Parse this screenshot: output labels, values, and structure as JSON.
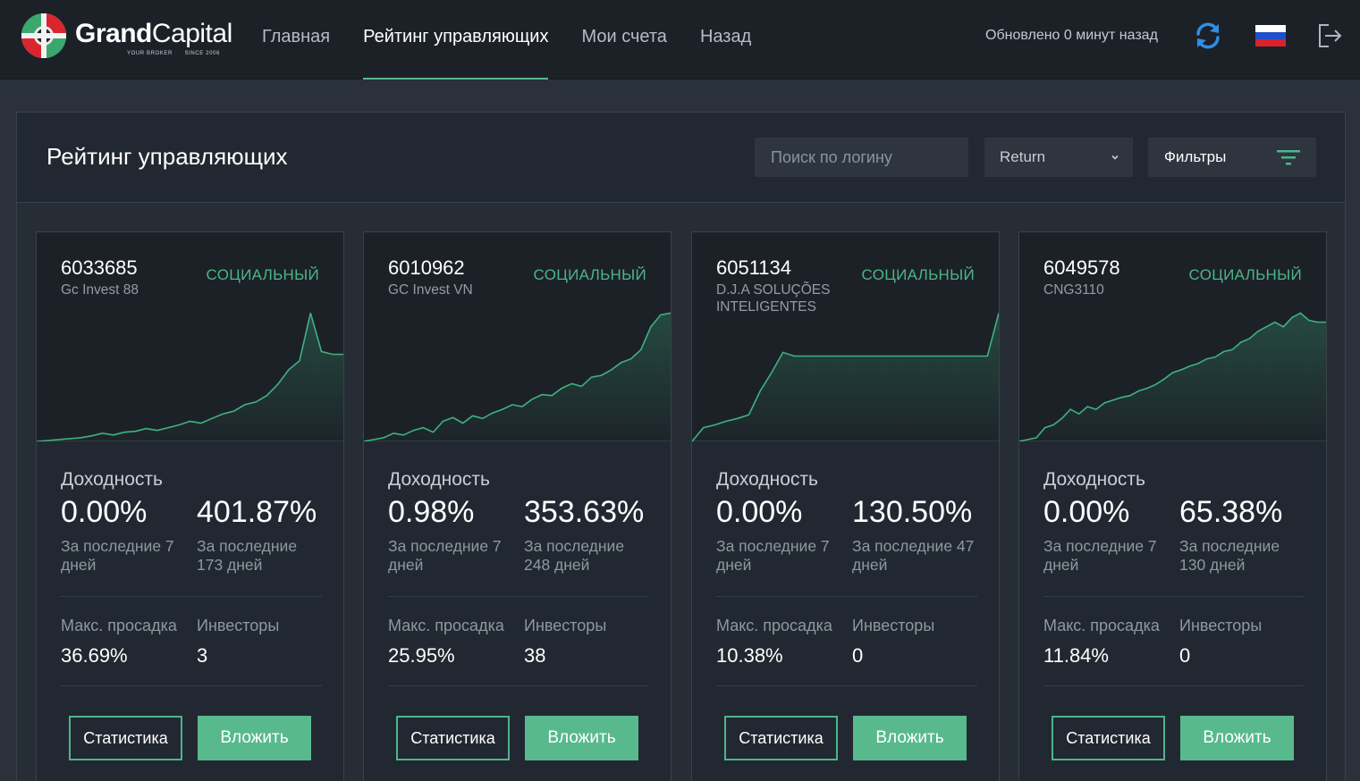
{
  "header": {
    "logo": {
      "brand_bold": "Grand",
      "brand_light": "Capital",
      "tagline_left": "YOUR BROKER",
      "tagline_right": "SINCE 2006"
    },
    "nav": [
      {
        "label": "Главная",
        "active": false
      },
      {
        "label": "Рейтинг управляющих",
        "active": true
      },
      {
        "label": "Мои счета",
        "active": false
      },
      {
        "label": "Назад",
        "active": false
      }
    ],
    "updated_text": "Обновлено 0 минут назад",
    "language_flag": "russia-flag",
    "icons": [
      "refresh-icon",
      "logout-icon"
    ]
  },
  "page": {
    "title": "Рейтинг управляющих",
    "search_placeholder": "Поиск по логину",
    "sort_value": "Return",
    "filters_label": "Фильтры"
  },
  "labels": {
    "section_title": "Доходность",
    "last7": "За последние 7 дней",
    "max_drawdown": "Макс. просадка",
    "investors": "Инвесторы",
    "stats_button": "Статистика",
    "invest_button": "Вложить"
  },
  "colors": {
    "accent": "#4cb687",
    "button": "#58b98d",
    "chart_line": "#3fb27f"
  },
  "cards": [
    {
      "login": "6033685",
      "name": "Gc Invest 88",
      "tag": "СОЦИАЛЬНЫЙ",
      "return_7d": "0.00%",
      "return_total": "401.87%",
      "total_period": "За последние 173 дней",
      "max_drawdown": "36.69%",
      "investors": "3",
      "chart_data": {
        "type": "area",
        "y": [
          0,
          1,
          2,
          3,
          4,
          6,
          9,
          7,
          10,
          11,
          14,
          12,
          15,
          18,
          22,
          20,
          25,
          30,
          33,
          40,
          43,
          50,
          62,
          78,
          88,
          140,
          98,
          95,
          95
        ],
        "ylim": [
          0,
          150
        ]
      }
    },
    {
      "login": "6010962",
      "name": "GC Invest VN",
      "tag": "СОЦИАЛЬНЫЙ",
      "return_7d": "0.98%",
      "return_total": "353.63%",
      "total_period": "За последние 248 дней",
      "max_drawdown": "25.95%",
      "investors": "38",
      "chart_data": {
        "type": "area",
        "y": [
          0,
          2,
          4,
          9,
          7,
          12,
          15,
          10,
          22,
          26,
          20,
          28,
          25,
          31,
          35,
          40,
          38,
          46,
          51,
          50,
          58,
          63,
          60,
          70,
          72,
          78,
          86,
          90,
          100,
          125,
          138,
          140
        ],
        "ylim": [
          0,
          150
        ]
      }
    },
    {
      "login": "6051134",
      "name": "D.J.A SOLUÇÕES INTELIGENTES",
      "tag": "СОЦИАЛЬНЫЙ",
      "return_7d": "0.00%",
      "return_total": "130.50%",
      "total_period": "За последние 47 дней",
      "max_drawdown": "10.38%",
      "investors": "0",
      "chart_data": {
        "type": "area",
        "y": [
          0,
          15,
          18,
          22,
          25,
          29,
          55,
          75,
          97,
          93,
          93,
          93,
          93,
          93,
          93,
          93,
          93,
          93,
          93,
          93,
          93,
          93,
          93,
          93,
          93,
          93,
          93,
          140
        ],
        "ylim": [
          0,
          150
        ]
      }
    },
    {
      "login": "6049578",
      "name": "CNG3110",
      "tag": "СОЦИАЛЬНЫЙ",
      "return_7d": "0.00%",
      "return_total": "65.38%",
      "total_period": "За последние 130 дней",
      "max_drawdown": "11.84%",
      "investors": "0",
      "chart_data": {
        "type": "area",
        "y": [
          0,
          2,
          4,
          15,
          18,
          25,
          35,
          30,
          38,
          35,
          42,
          45,
          48,
          50,
          55,
          58,
          62,
          68,
          75,
          78,
          82,
          85,
          90,
          92,
          98,
          100,
          108,
          112,
          120,
          125,
          130,
          125,
          135,
          140,
          132,
          130,
          130
        ],
        "ylim": [
          0,
          150
        ]
      }
    }
  ]
}
